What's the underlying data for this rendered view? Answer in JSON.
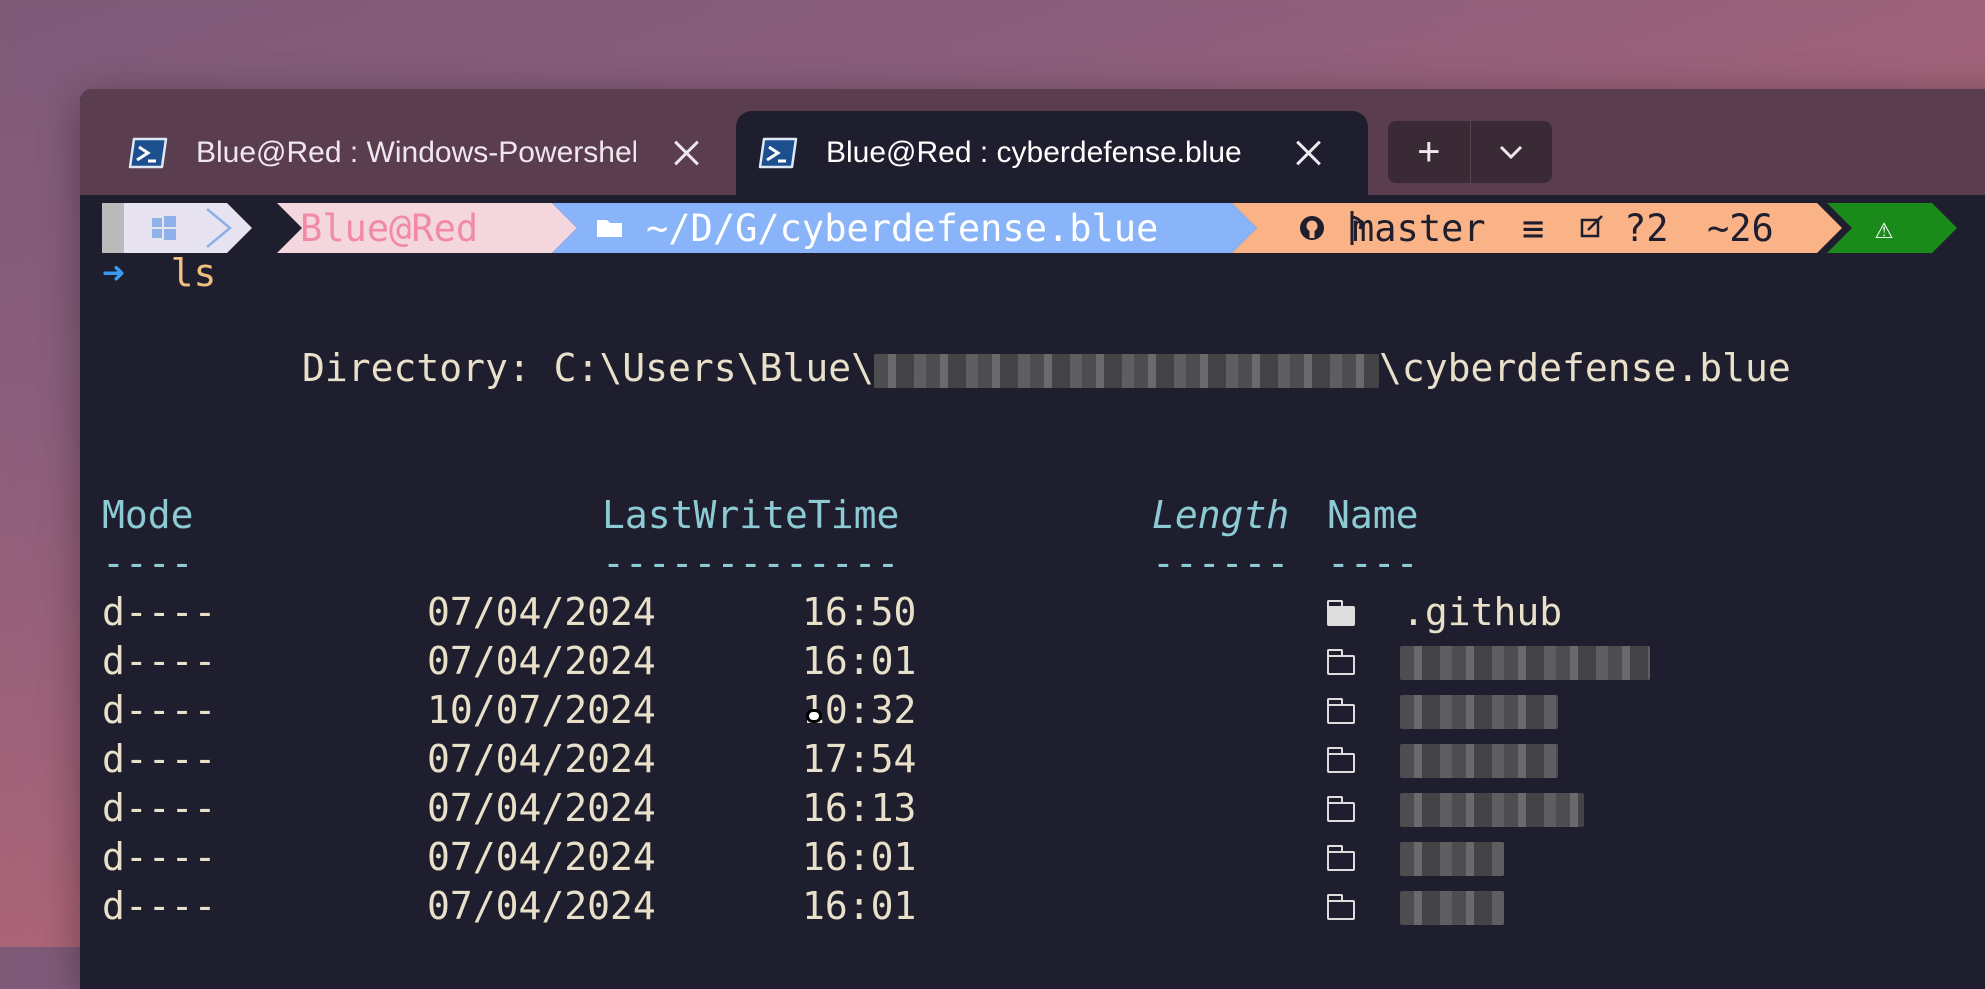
{
  "tabs": [
    {
      "label": "Blue@Red : Windows-Powershell",
      "active": false
    },
    {
      "label": "Blue@Red : cyberdefense.blue",
      "active": true
    }
  ],
  "tab_buttons": {
    "new_tab": "+",
    "dropdown": "⌄"
  },
  "prompt": {
    "user": "Blue@Red",
    "path": "~/D/G/cyberdefense.blue",
    "branch": "master",
    "status_symbol": "≡",
    "untracked": "?2",
    "modified": "~26",
    "warning": "⚠",
    "arrow": "➜",
    "command": "ls",
    "colors": {
      "user_bg": "#f3d6de",
      "user_fg": "#f08aa8",
      "path_bg": "#89b4fa",
      "git_bg": "#fab387",
      "warn_bg": "#1a8a1a"
    }
  },
  "directory": {
    "prefix": "Directory: C:\\Users\\Blue\\",
    "suffix": "\\cyberdefense.blue"
  },
  "columns": {
    "mode": "Mode",
    "lastwrite": "LastWriteTime",
    "length": "Length",
    "name": "Name",
    "mode_sep": "----",
    "lastwrite_sep": "-------------",
    "length_sep": "------",
    "name_sep": "----"
  },
  "rows": [
    {
      "mode": "d----",
      "date": "07/04/2024",
      "time": "16:50",
      "name": ".github",
      "icon": "github-folder-icon"
    },
    {
      "mode": "d----",
      "date": "07/04/2024",
      "time": "16:01",
      "name": "",
      "icon": "folder-icon"
    },
    {
      "mode": "d----",
      "date": "10/07/2024",
      "time": "10:32",
      "name": "",
      "icon": "folder-icon"
    },
    {
      "mode": "d----",
      "date": "07/04/2024",
      "time": "17:54",
      "name": "",
      "icon": "folder-icon"
    },
    {
      "mode": "d----",
      "date": "07/04/2024",
      "time": "16:13",
      "name": "",
      "icon": "folder-icon"
    },
    {
      "mode": "d----",
      "date": "07/04/2024",
      "time": "16:01",
      "name": "",
      "icon": "folder-icon"
    },
    {
      "mode": "d----",
      "date": "07/04/2024",
      "time": "16:01",
      "name": "",
      "icon": "folder-icon"
    }
  ]
}
